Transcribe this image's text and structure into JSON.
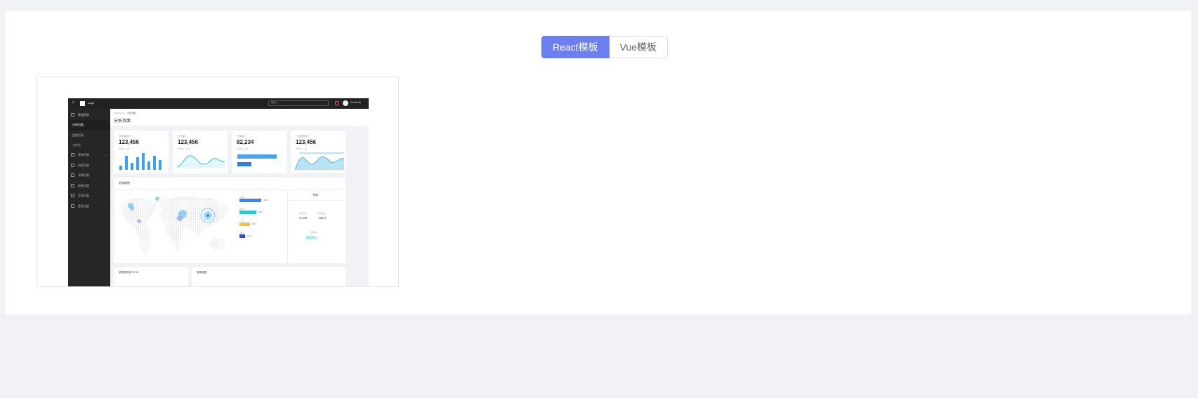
{
  "switcher": {
    "options": [
      {
        "label": "React模板",
        "active": true
      },
      {
        "label": "Vue模板",
        "active": false
      }
    ],
    "active_color": "#6b7ff0"
  },
  "preview": {
    "topbar": {
      "logo": "Logo",
      "search_placeholder": "搜索入",
      "user": "Serati Ma"
    },
    "sidebar": {
      "items": [
        {
          "label": "数据报表",
          "icon": "dashboard-icon",
          "caret": true,
          "active": false,
          "indent": false
        },
        {
          "label": "分析页面",
          "active": true,
          "indent": true
        },
        {
          "label": "监控页面",
          "active": false,
          "indent": true
        },
        {
          "label": "工作台",
          "active": false,
          "indent": true
        },
        {
          "label": "表单页面",
          "icon": "form-icon",
          "caret": true,
          "active": false,
          "indent": false
        },
        {
          "label": "列表页面",
          "icon": "table-icon",
          "caret": true,
          "active": false,
          "indent": false
        },
        {
          "label": "详情页面",
          "icon": "profile-icon",
          "caret": true,
          "active": false,
          "indent": false
        },
        {
          "label": "结果页面",
          "icon": "check-icon",
          "caret": true,
          "active": false,
          "indent": false
        },
        {
          "label": "异常页面",
          "icon": "warning-icon",
          "caret": true,
          "active": false,
          "indent": false
        },
        {
          "label": "登录注册",
          "icon": "user-icon",
          "caret": true,
          "active": false,
          "indent": false
        }
      ]
    },
    "breadcrumb": [
      "Dashboard",
      "分析页面"
    ],
    "page_title": "分析页面",
    "stats": [
      {
        "label": "访问量统计",
        "value": "123,456",
        "sub": "周同比 ↑ 8.5",
        "viz": "bars"
      },
      {
        "label": "访问量",
        "value": "123,456",
        "sub": "周同比 ↑ 8.5",
        "viz": "line"
      },
      {
        "label": "订单量",
        "value": "82,234",
        "sub": "周同比 ↑ 8.5",
        "viz": "hbars"
      },
      {
        "label": "门店营业额",
        "value": "123,456",
        "sub": "周同比 ↑ 8.5",
        "viz": "area"
      }
    ],
    "map_section": {
      "title": "区域销售",
      "legend": [
        {
          "label": "上海",
          "pct": "46%",
          "color": "#3a86f0",
          "level": 0.46
        },
        {
          "label": "北京",
          "pct": "36%",
          "color": "#2ec7c9",
          "level": 0.36
        },
        {
          "label": "广州",
          "pct": "26%",
          "color": "#f0c43a",
          "level": 0.26
        },
        {
          "label": "深圳",
          "pct": "13%",
          "color": "#3448c5",
          "level": 0.13
        }
      ],
      "side": {
        "title": "完成",
        "a_label": "本月目标",
        "a_value": "6,123",
        "b_label": "本月完成",
        "b_value": "132,4",
        "rate_label": "完成率",
        "rate": "45%↑"
      }
    },
    "bottom": [
      "销售额排名TOP10",
      "搜索数据"
    ]
  }
}
